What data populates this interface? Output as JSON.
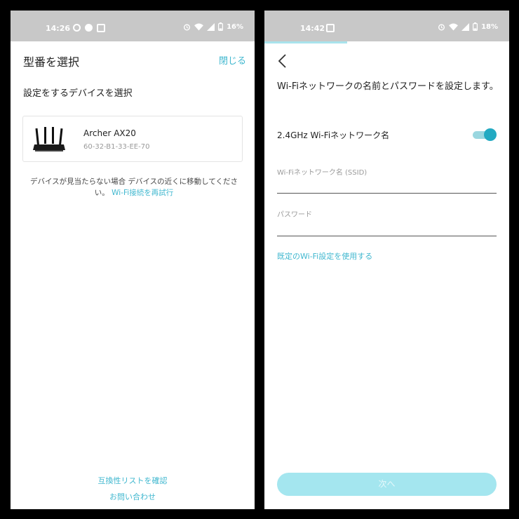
{
  "left": {
    "statusbar": {
      "time": "14:26",
      "battery": "16%"
    },
    "title": "型番を選択",
    "close_label": "閉じる",
    "subtitle": "設定をするデバイスを選択",
    "device": {
      "name": "Archer AX20",
      "mac": "60-32-B1-33-EE-70"
    },
    "notfound_text": "デバイスが見当たらない場合 デバイスの近くに移動してください。",
    "retry_link": "Wi-Fi接続を再試行",
    "compat_link": "互換性リストを確認",
    "contact_link": "お問い合わせ"
  },
  "right": {
    "statusbar": {
      "time": "14:42",
      "battery": "18%"
    },
    "title": "Wi-Fiネットワークの名前とパスワードを設定します。",
    "wifi_label": "2.4GHz Wi-Fiネットワーク名",
    "toggle_on": true,
    "ssid_placeholder": "Wi-Fiネットワーク名 (SSID)",
    "password_placeholder": "パスワード",
    "default_link": "既定のWi-Fi設定を使用する",
    "next_label": "次へ"
  },
  "colors": {
    "accent": "#3fb7cf",
    "statusbar": "#c8c8c8",
    "button_disabled": "#a4e6ef"
  },
  "icons": [
    "alarm-icon",
    "wifi-icon",
    "signal-icon",
    "battery-icon",
    "back-arrow-icon",
    "router-icon"
  ]
}
